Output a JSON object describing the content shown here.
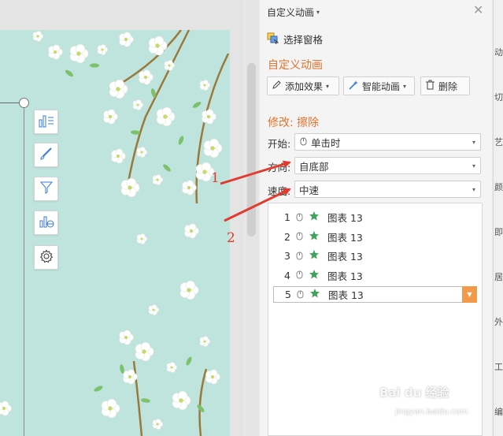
{
  "panel": {
    "title": "自定义动画",
    "select_pane_label": "选择窗格",
    "section_heading": "自定义动画",
    "buttons": {
      "add_effect": "添加效果",
      "smart_animation": "智能动画",
      "delete": "删除"
    },
    "modify_heading": "修改: 擦除",
    "fields": {
      "start_label": "开始:",
      "start_value": "单击时",
      "direction_label": "方向:",
      "direction_value": "自底部",
      "speed_label": "速度:",
      "speed_value": "中速"
    },
    "animation_list": [
      {
        "num": "1",
        "name": "图表 13"
      },
      {
        "num": "2",
        "name": "图表 13"
      },
      {
        "num": "3",
        "name": "图表 13"
      },
      {
        "num": "4",
        "name": "图表 13"
      },
      {
        "num": "5",
        "name": "图表 13"
      }
    ]
  },
  "right_strip_chars": [
    "动",
    "切",
    "艺",
    "颜",
    "即",
    "居",
    "外",
    "工",
    "编"
  ],
  "annotations": {
    "first": "1",
    "second": "2"
  },
  "watermark": {
    "brand": "Bai du 经验",
    "sub": "jingyan.baidu.com"
  },
  "colors": {
    "accent_orange": "#e2742e",
    "annotation_red": "#e23b2e",
    "slide_bg": "#bfe3dd"
  }
}
